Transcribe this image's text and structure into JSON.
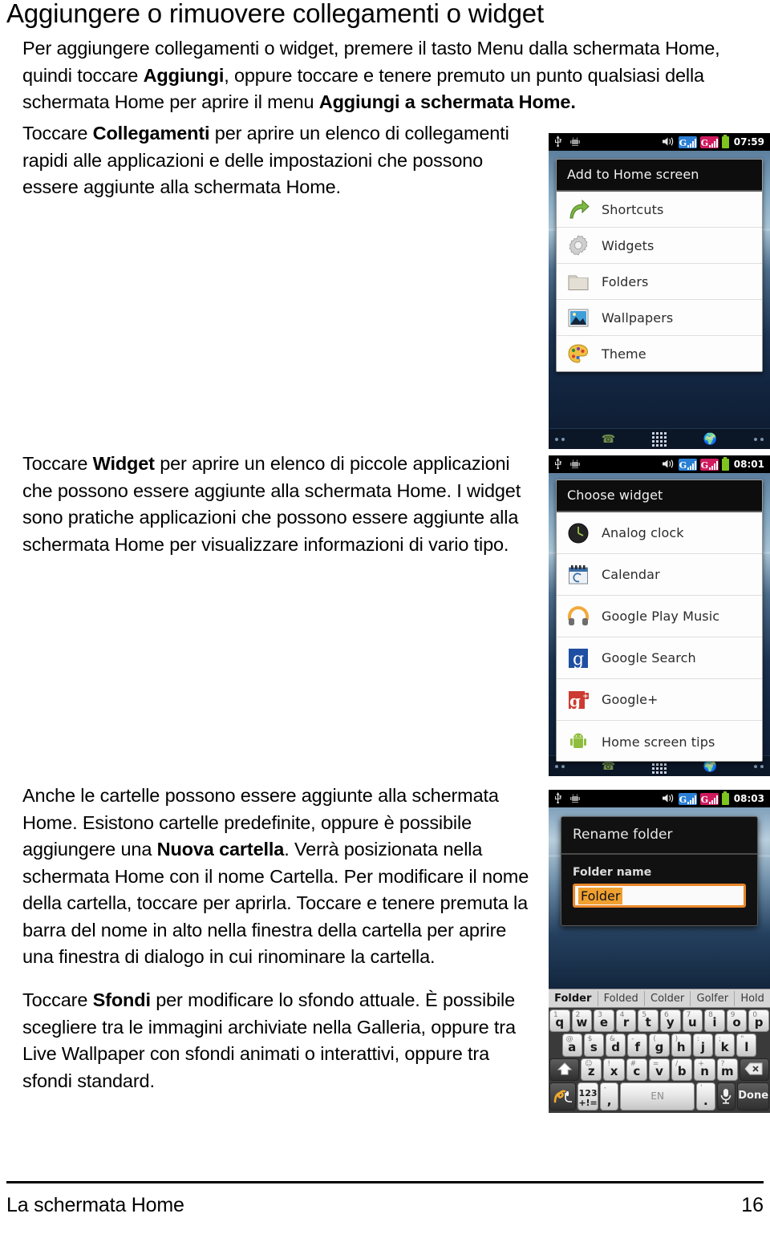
{
  "document": {
    "title": "Aggiungere o rimuovere collegamenti o widget",
    "paragraphs": {
      "intro_1": "Per aggiungere collegamenti o widget, premere il tasto Menu dalla schermata Home, quindi toccare ",
      "intro_b1": "Aggiungi",
      "intro_2": ", oppure toccare e tenere premuto un punto qualsiasi della schermata Home per aprire il menu ",
      "intro_b2": "Aggiungi a schermata Home.",
      "shortcuts_1": "Toccare ",
      "shortcuts_b": "Collegamenti",
      "shortcuts_2": " per aprire un elenco di collegamenti rapidi alle applicazioni e delle impostazioni che possono essere aggiunte alla schermata Home.",
      "widget_1": "Toccare ",
      "widget_b": "Widget",
      "widget_2": " per aprire un elenco di piccole applicazioni che possono essere aggiunte alla schermata Home. I widget sono pratiche applicazioni che possono essere aggiunte alla schermata Home per visualizzare informazioni di vario tipo.",
      "folders_1": "Anche le cartelle possono essere aggiunte alla schermata Home. Esistono cartelle predefinite, oppure è possibile aggiungere una ",
      "folders_b": "Nuova cartella",
      "folders_2": ". Verrà posizionata nella schermata Home con il nome Cartella. Per modificare il nome della cartella, toccare per aprirla. Toccare e tenere premuta la barra del nome in alto nella finestra della cartella per aprire una finestra di dialogo in cui rinominare la cartella.",
      "wallpaper_1": "Toccare ",
      "wallpaper_b": "Sfondi",
      "wallpaper_2": " per modificare lo sfondo attuale. È possibile scegliere tra le immagini archiviate nella Galleria, oppure tra Live Wallpaper con sfondi animati o interattivi, oppure tra sfondi standard."
    },
    "footer": {
      "section": "La schermata Home",
      "page_number": "16"
    }
  },
  "screenshot_add_to_home": {
    "statusbar": {
      "usb_icon": "usb-icon",
      "debug_icon": "android-debug-icon",
      "sound_icon": "speaker-icon",
      "sim1_icon": "signal-sim1-icon",
      "sim2_icon": "signal-sim2-icon",
      "battery_icon": "battery-icon",
      "clock": "07:59"
    },
    "dialog_title": "Add to Home screen",
    "items": [
      {
        "icon": "shortcut-arrow-icon",
        "label": "Shortcuts"
      },
      {
        "icon": "gear-icon",
        "label": "Widgets"
      },
      {
        "icon": "folder-icon",
        "label": "Folders"
      },
      {
        "icon": "picture-icon",
        "label": "Wallpapers"
      },
      {
        "icon": "palette-icon",
        "label": "Theme"
      }
    ],
    "dock": {
      "phone_icon": "phone-icon",
      "apps_icon": "app-grid-icon",
      "browser_icon": "globe-icon"
    }
  },
  "screenshot_choose_widget": {
    "statusbar": {
      "usb_icon": "usb-icon",
      "debug_icon": "android-debug-icon",
      "sound_icon": "speaker-icon",
      "sim1_icon": "signal-sim1-icon",
      "sim2_icon": "signal-sim2-icon",
      "battery_icon": "battery-icon",
      "clock": "08:01"
    },
    "dialog_title": "Choose widget",
    "items": [
      {
        "icon": "analog-clock-icon",
        "label": "Analog clock"
      },
      {
        "icon": "calendar-icon",
        "label": "Calendar"
      },
      {
        "icon": "headphones-icon",
        "label": "Google Play Music"
      },
      {
        "icon": "google-g-icon",
        "label": "Google Search"
      },
      {
        "icon": "google-plus-icon",
        "label": "Google+"
      },
      {
        "icon": "android-robot-icon",
        "label": "Home screen tips"
      }
    ]
  },
  "screenshot_rename_folder": {
    "statusbar": {
      "usb_icon": "usb-icon",
      "debug_icon": "android-debug-icon",
      "sound_icon": "speaker-icon",
      "sim1_icon": "signal-sim1-icon",
      "sim2_icon": "signal-sim2-icon",
      "battery_icon": "battery-icon",
      "clock": "08:03"
    },
    "dialog_title": "Rename folder",
    "field_label": "Folder name",
    "field_value": "Folder",
    "suggestions": [
      "Folder",
      "Folded",
      "Colder",
      "Golfer",
      "Hold"
    ],
    "keyboard": {
      "row1": [
        {
          "alt": "1",
          "key": "q"
        },
        {
          "alt": "2",
          "key": "w"
        },
        {
          "alt": "3",
          "key": "e"
        },
        {
          "alt": "4",
          "key": "r"
        },
        {
          "alt": "5",
          "key": "t"
        },
        {
          "alt": "6",
          "key": "y"
        },
        {
          "alt": "7",
          "key": "u"
        },
        {
          "alt": "8",
          "key": "i"
        },
        {
          "alt": "9",
          "key": "o"
        },
        {
          "alt": "0",
          "key": "p"
        }
      ],
      "row2": [
        {
          "alt": "@",
          "key": "a"
        },
        {
          "alt": "$",
          "key": "s"
        },
        {
          "alt": "&",
          "key": "d"
        },
        {
          "alt": "-",
          "key": "f"
        },
        {
          "alt": "(",
          "key": "g"
        },
        {
          "alt": ")",
          "key": "h"
        },
        {
          "alt": ":",
          "key": "j"
        },
        {
          "alt": ";",
          "key": "k"
        },
        {
          "alt": "\"",
          "key": "l"
        }
      ],
      "row3": [
        {
          "alt": "☺",
          "key": "z"
        },
        {
          "alt": "!",
          "key": "x"
        },
        {
          "alt": "#",
          "key": "c"
        },
        {
          "alt": "=",
          "key": "v"
        },
        {
          "alt": "/",
          "key": "b"
        },
        {
          "alt": "+",
          "key": "n"
        },
        {
          "alt": "?",
          "key": "m"
        }
      ],
      "shift_icon": "shift-up-icon",
      "backspace_icon": "backspace-icon",
      "handwriting_icon": "handwriting-icon",
      "symbols_top": "123",
      "symbols_bottom": "+!=",
      "comma_alt": "-",
      "comma_key": ",",
      "space_label": "EN",
      "period_alt": "'",
      "period_key": ".",
      "mic_icon": "microphone-icon",
      "done_label": "Done"
    }
  }
}
